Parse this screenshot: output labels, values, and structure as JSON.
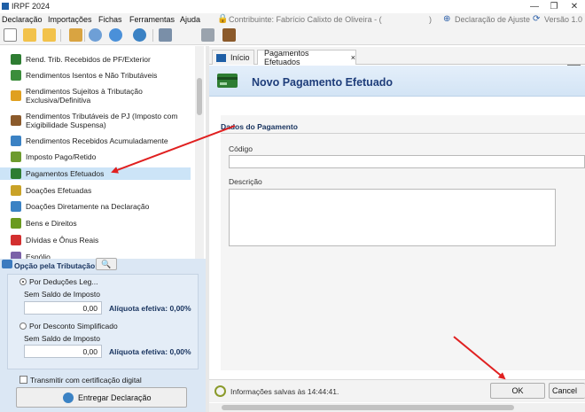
{
  "window": {
    "title": "IRPF 2024"
  },
  "menu": [
    {
      "label": "Declaração"
    },
    {
      "label": "Importações"
    },
    {
      "label": "Fichas"
    },
    {
      "label": "Ferramentas"
    },
    {
      "label": "Ajuda"
    }
  ],
  "header": {
    "contribuinte": "Contribuinte: Fabrício Calixto de Oliveira - (",
    "declaracao": "Declaração de Ajuste",
    "versao": "Versão 1.0"
  },
  "nav": [
    {
      "label": "Rend. Trib. Recebidos de PF/Exterior",
      "icon": "income-person-icon"
    },
    {
      "label": "Rendimentos Isentos e Não Tributáveis",
      "icon": "check-document-icon"
    },
    {
      "label": "Rendimentos Sujeitos à Tributação Exclusiva/Definitiva",
      "icon": "warning-document-icon"
    },
    {
      "label": "Rendimentos Tributáveis de PJ (Imposto com Exigibilidade Suspensa)",
      "icon": "gavel-document-icon"
    },
    {
      "label": "Rendimentos Recebidos Acumuladamente",
      "icon": "accumulated-document-icon"
    },
    {
      "label": "Imposto Pago/Retido",
      "icon": "tax-paid-icon"
    },
    {
      "label": "Pagamentos Efetuados",
      "icon": "payment-card-icon"
    },
    {
      "label": "Doações Efetuadas",
      "icon": "donation-icon"
    },
    {
      "label": "Doações Diretamente na Declaração",
      "icon": "direct-donation-icon"
    },
    {
      "label": "Bens e Direitos",
      "icon": "assets-icon"
    },
    {
      "label": "Dívidas e Ônus Reais",
      "icon": "debts-icon"
    },
    {
      "label": "Espólio",
      "icon": "estate-icon"
    }
  ],
  "tax_option": {
    "heading": "Opção pela Tributação:",
    "deducoes_label": "Por Deduções Leg...",
    "saldo_label_1": "Sem Saldo de Imposto",
    "valor_1": "0,00",
    "aliquota_1": "Alíquota efetiva: 0,00%",
    "simplificado_label": "Por Desconto Simplificado",
    "saldo_label_2": "Sem Saldo de Imposto",
    "valor_2": "0,00",
    "aliquota_2": "Alíquota efetiva: 0,00%",
    "certificado_label": "Transmitir com certificação digital",
    "entregar_label": "Entregar Declaração"
  },
  "tabs": [
    {
      "label": "Início"
    },
    {
      "label": "Pagamentos Efetuados",
      "close": "×"
    }
  ],
  "banner": {
    "title": "Novo Pagamento Efetuado"
  },
  "form": {
    "section": "Dados do Pagamento",
    "codigo_label": "Código",
    "codigo_value": "",
    "descricao_label": "Descrição",
    "descricao_value": ""
  },
  "status": {
    "message": "Informações salvas às 14:44:41.",
    "ok_label": "OK",
    "cancel_label": "Cancel"
  },
  "colors": {
    "accent": "#1e3d7a",
    "selection": "#cce4f7",
    "annotation_arrow": "#e02020"
  }
}
